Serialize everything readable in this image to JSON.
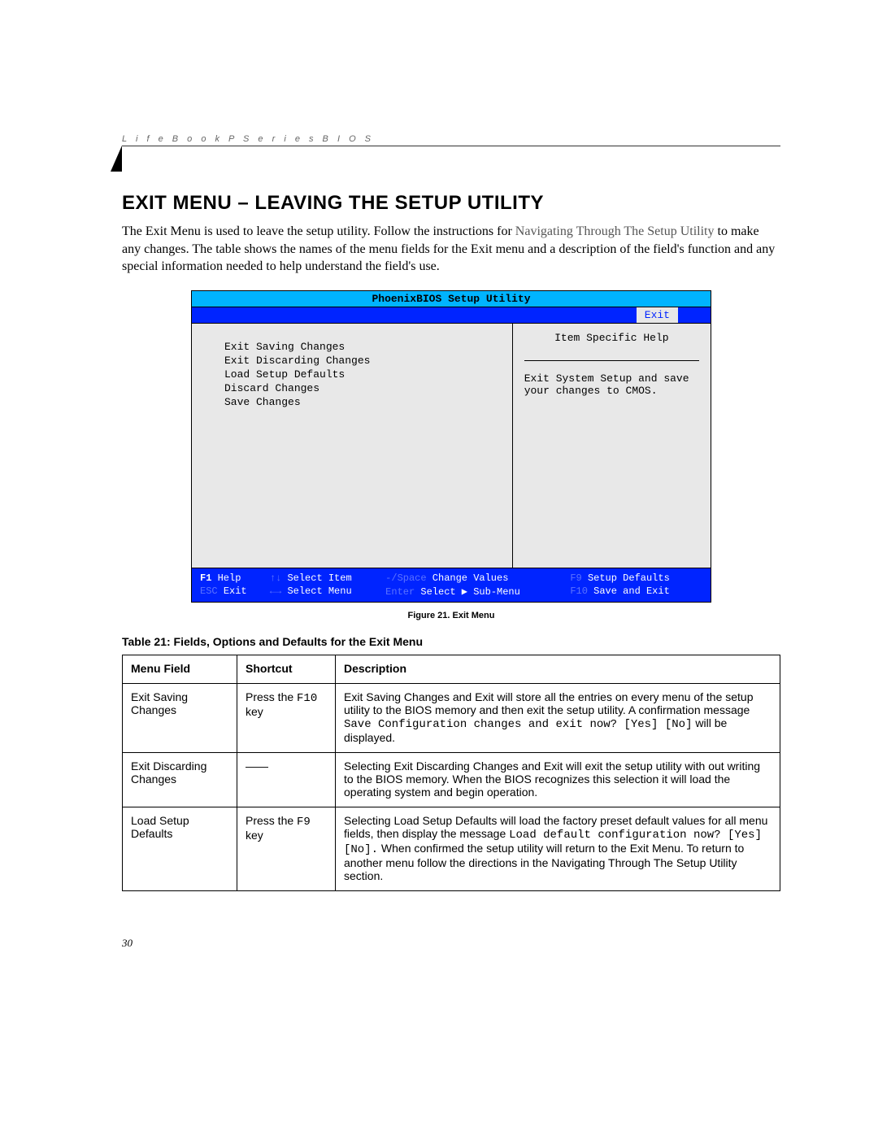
{
  "header": {
    "text": "L i f e B o o k   P   S e r i e s   B I O S"
  },
  "section": {
    "title": "EXIT MENU – LEAVING THE SETUP UTILITY",
    "body_pre": "The Exit Menu is used to leave the setup utility. Follow the instructions for ",
    "body_link": "Navigating Through The Setup Utility",
    "body_post": " to make any changes. The table shows the names of the menu fields for the Exit menu and a description of the field's function and any special information needed to help understand the field's use."
  },
  "bios": {
    "title": "PhoenixBIOS Setup Utility",
    "tab_selected": "Exit",
    "menu_items": [
      "Exit Saving Changes",
      "Exit Discarding Changes",
      "Load Setup Defaults",
      "Discard Changes",
      "Save Changes"
    ],
    "help_title": "Item Specific Help",
    "help_text": "Exit System Setup and save your changes to CMOS.",
    "footer": {
      "r1": [
        {
          "key": "F1",
          "label": "Help"
        },
        {
          "key": "↑↓",
          "label": "Select Item"
        },
        {
          "key": "-/Space",
          "label": "Change Values"
        },
        {
          "key": "F9",
          "label": "Setup Defaults"
        }
      ],
      "r2": [
        {
          "key": "ESC",
          "label": "Exit"
        },
        {
          "key": "←→",
          "label": "Select Menu"
        },
        {
          "key": "Enter",
          "label": "Select ▶ Sub-Menu"
        },
        {
          "key": "F10",
          "label": "Save and Exit"
        }
      ]
    }
  },
  "figure_caption": "Figure 21.  Exit Menu",
  "table": {
    "title": "Table 21: Fields, Options and Defaults for the Exit Menu",
    "headers": [
      "Menu Field",
      "Shortcut",
      "Description"
    ],
    "rows": [
      {
        "field": "Exit Saving Changes",
        "shortcut_pre": "Press the ",
        "shortcut_key": "F10",
        "shortcut_post": " key",
        "desc_pre": "Exit Saving Changes and Exit will store all the entries on every menu of the setup utility to the BIOS memory and then exit the setup utility. A confirmation message ",
        "desc_code": "Save Configuration changes and exit now? [Yes] [No]",
        "desc_post": " will be displayed."
      },
      {
        "field": "Exit Discarding Changes",
        "shortcut_pre": "——",
        "shortcut_key": "",
        "shortcut_post": "",
        "desc_pre": "Selecting Exit Discarding Changes and Exit will exit the setup utility with out writing to the BIOS memory. When the BIOS recognizes this selection it will load the operating system and begin operation.",
        "desc_code": "",
        "desc_post": ""
      },
      {
        "field": "Load Setup Defaults",
        "shortcut_pre": "Press the ",
        "shortcut_key": "F9",
        "shortcut_post": " key",
        "desc_pre": "Selecting Load Setup Defaults will load the factory preset default values for all menu fields, then display the message ",
        "desc_code": "Load default configuration now? [Yes] [No].",
        "desc_post_1": " When confirmed the setup utility will return to the Exit Menu. To return to another menu follow the directions in the ",
        "desc_link": "Navigating Through The Setup Utility",
        "desc_post_2": " section."
      }
    ]
  },
  "page_number": "30"
}
